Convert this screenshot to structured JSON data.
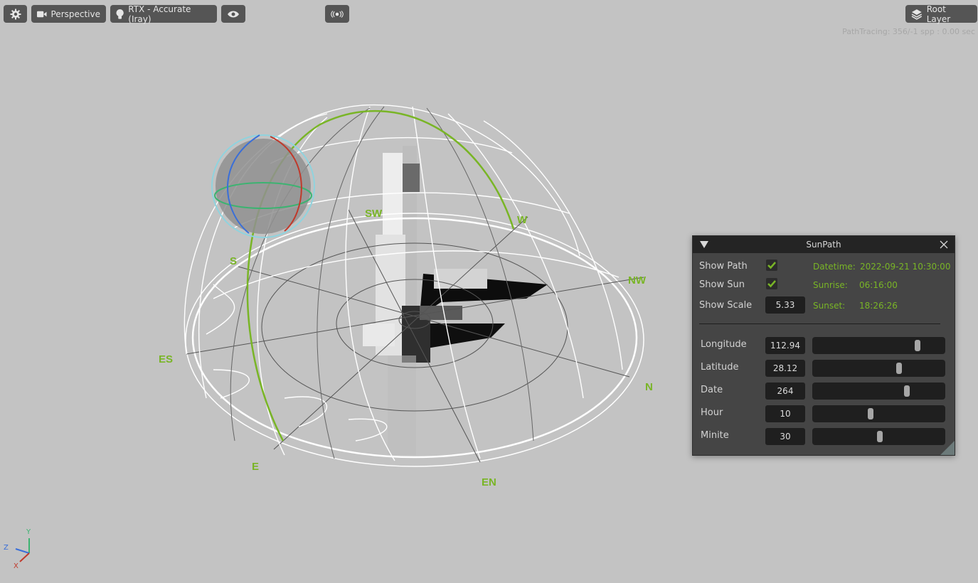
{
  "toolbar": {
    "camera_label": "Perspective",
    "renderer_label": "RTX - Accurate (Iray)",
    "layer_label": "Root Layer"
  },
  "viewport": {
    "stats": "PathTracing: 356/-1 spp : 0.00 sec",
    "compass": {
      "sw": "SW",
      "w": "W",
      "s": "S",
      "nw": "NW",
      "es": "ES",
      "n": "N",
      "e": "E",
      "en": "EN"
    },
    "axes": {
      "y": "Y",
      "z": "Z",
      "x": "X"
    },
    "colors": {
      "path": "#79b526",
      "axis_x": "#c0392b",
      "axis_y": "#3cb371",
      "axis_z": "#3a6fd8"
    }
  },
  "sunpath": {
    "title": "SunPath",
    "show_path_label": "Show Path",
    "show_sun_label": "Show   Sun",
    "show_scale_label": "Show Scale",
    "show_path_checked": true,
    "show_sun_checked": true,
    "show_scale_value": "5.33",
    "datetime_label": "Datetime:",
    "datetime_value": "2022-09-21 10:30:00",
    "sunrise_label": "Sunrise:",
    "sunrise_value": "06:16:00",
    "sunset_label": "Sunset:",
    "sunset_value": "18:26:26",
    "accent_color": "#79b526",
    "sliders": [
      {
        "label": "Longitude",
        "value": "112.94",
        "fraction": 0.79
      },
      {
        "label": "Latitude",
        "value": "28.12",
        "fraction": 0.65
      },
      {
        "label": "Date",
        "value": "264",
        "fraction": 0.71
      },
      {
        "label": "Hour",
        "value": "10",
        "fraction": 0.44
      },
      {
        "label": "Minite",
        "value": "30",
        "fraction": 0.51
      }
    ]
  }
}
